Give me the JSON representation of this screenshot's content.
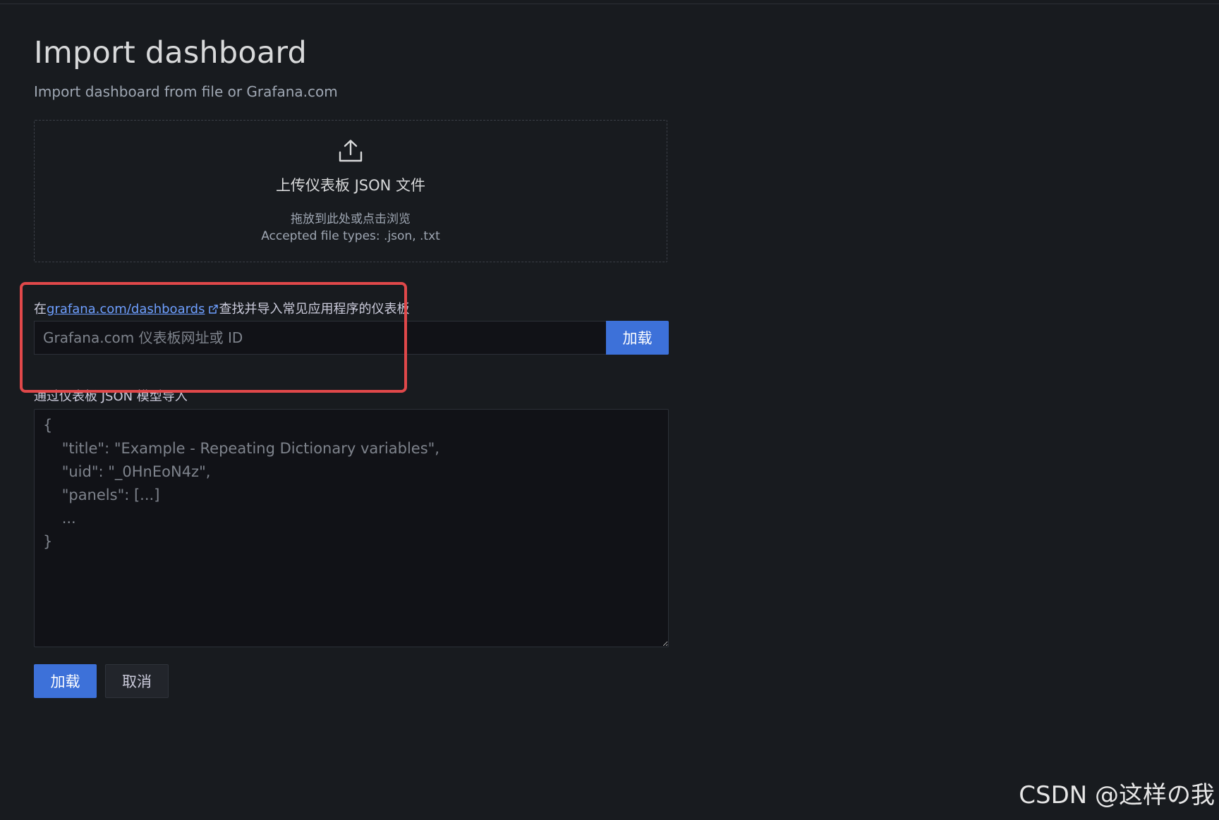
{
  "header": {
    "title": "Import dashboard",
    "subtitle": "Import dashboard from file or Grafana.com"
  },
  "upload": {
    "icon": "upload-icon",
    "title": "上传仪表板 JSON 文件",
    "hint": "拖放到此处或点击浏览",
    "accepted_types": "Accepted file types: .json, .txt"
  },
  "gcom": {
    "label_prefix": "在",
    "link_text": "grafana.com/dashboards",
    "link_icon": "external-link-icon",
    "label_suffix": "查找并导入常见应用程序的仪表板",
    "input_value": "",
    "input_placeholder": "Grafana.com 仪表板网址或 ID",
    "load_label": "加载"
  },
  "json_model": {
    "label": "通过仪表板 JSON 模型导入",
    "value": "",
    "placeholder": "{\n    \"title\": \"Example - Repeating Dictionary variables\",\n    \"uid\": \"_0HnEoN4z\",\n    \"panels\": [...]\n    ...\n}"
  },
  "actions": {
    "load_label": "加载",
    "cancel_label": "取消"
  },
  "colors": {
    "background": "#181b1f",
    "primary": "#3d71d9",
    "link": "#6e9fff",
    "highlight": "#e0484a"
  },
  "watermark": "CSDN @这样の我"
}
